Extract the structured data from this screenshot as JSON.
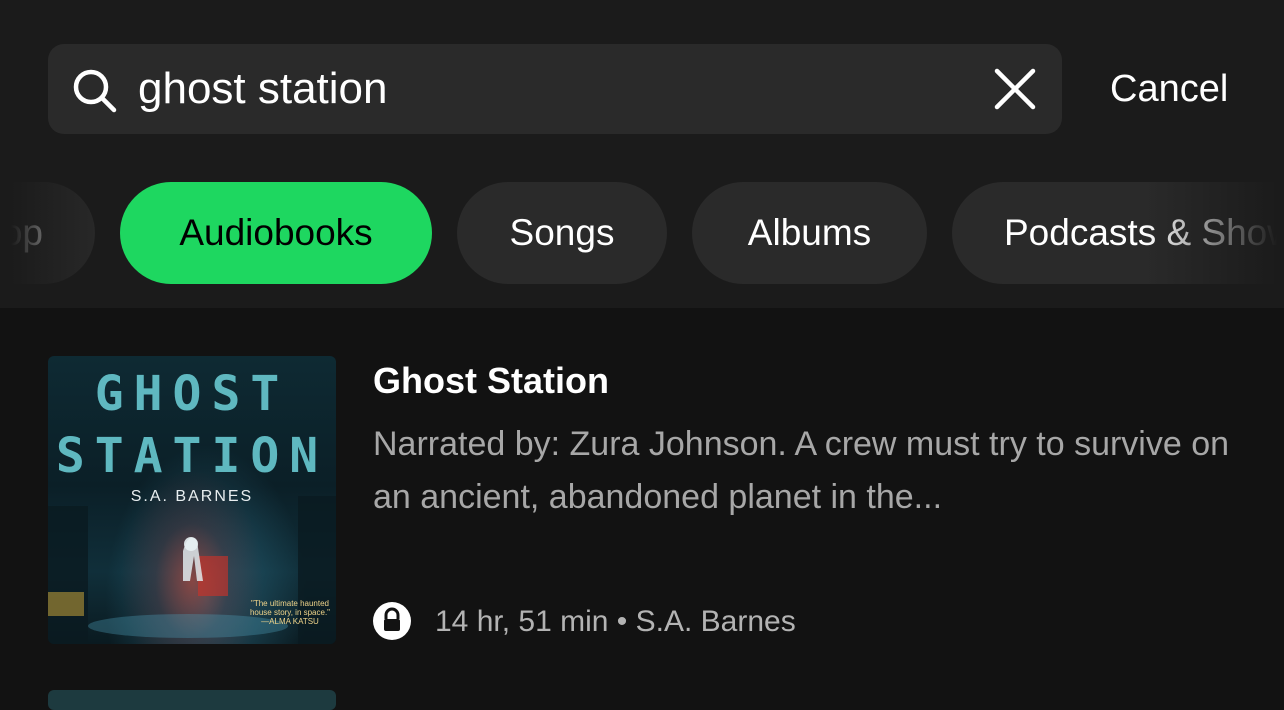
{
  "search": {
    "query": "ghost station",
    "cancel_label": "Cancel"
  },
  "filters": [
    {
      "label": "op",
      "active": false
    },
    {
      "label": "Audiobooks",
      "active": true
    },
    {
      "label": "Songs",
      "active": false
    },
    {
      "label": "Albums",
      "active": false
    },
    {
      "label": "Podcasts & Shows",
      "active": false
    }
  ],
  "result": {
    "title": "Ghost Station",
    "description": "Narrated by: Zura Johnson. A crew must try to survive on an ancient, abandoned planet in the...",
    "duration": "14 hr, 51 min",
    "separator": "•",
    "author": "S.A. Barnes",
    "cover": {
      "title_line1": "GHOST",
      "title_line2": "STATION",
      "author": "S.A. BARNES",
      "quote": "\"The ultimate haunted house story, in space.\" —ALMA KATSU"
    }
  },
  "colors": {
    "accent": "#1ed760",
    "background": "#121212",
    "chip": "#2a2a2a",
    "secondary_text": "#a7a7a7"
  },
  "icons": [
    "search-icon",
    "close-icon",
    "lock-icon"
  ]
}
